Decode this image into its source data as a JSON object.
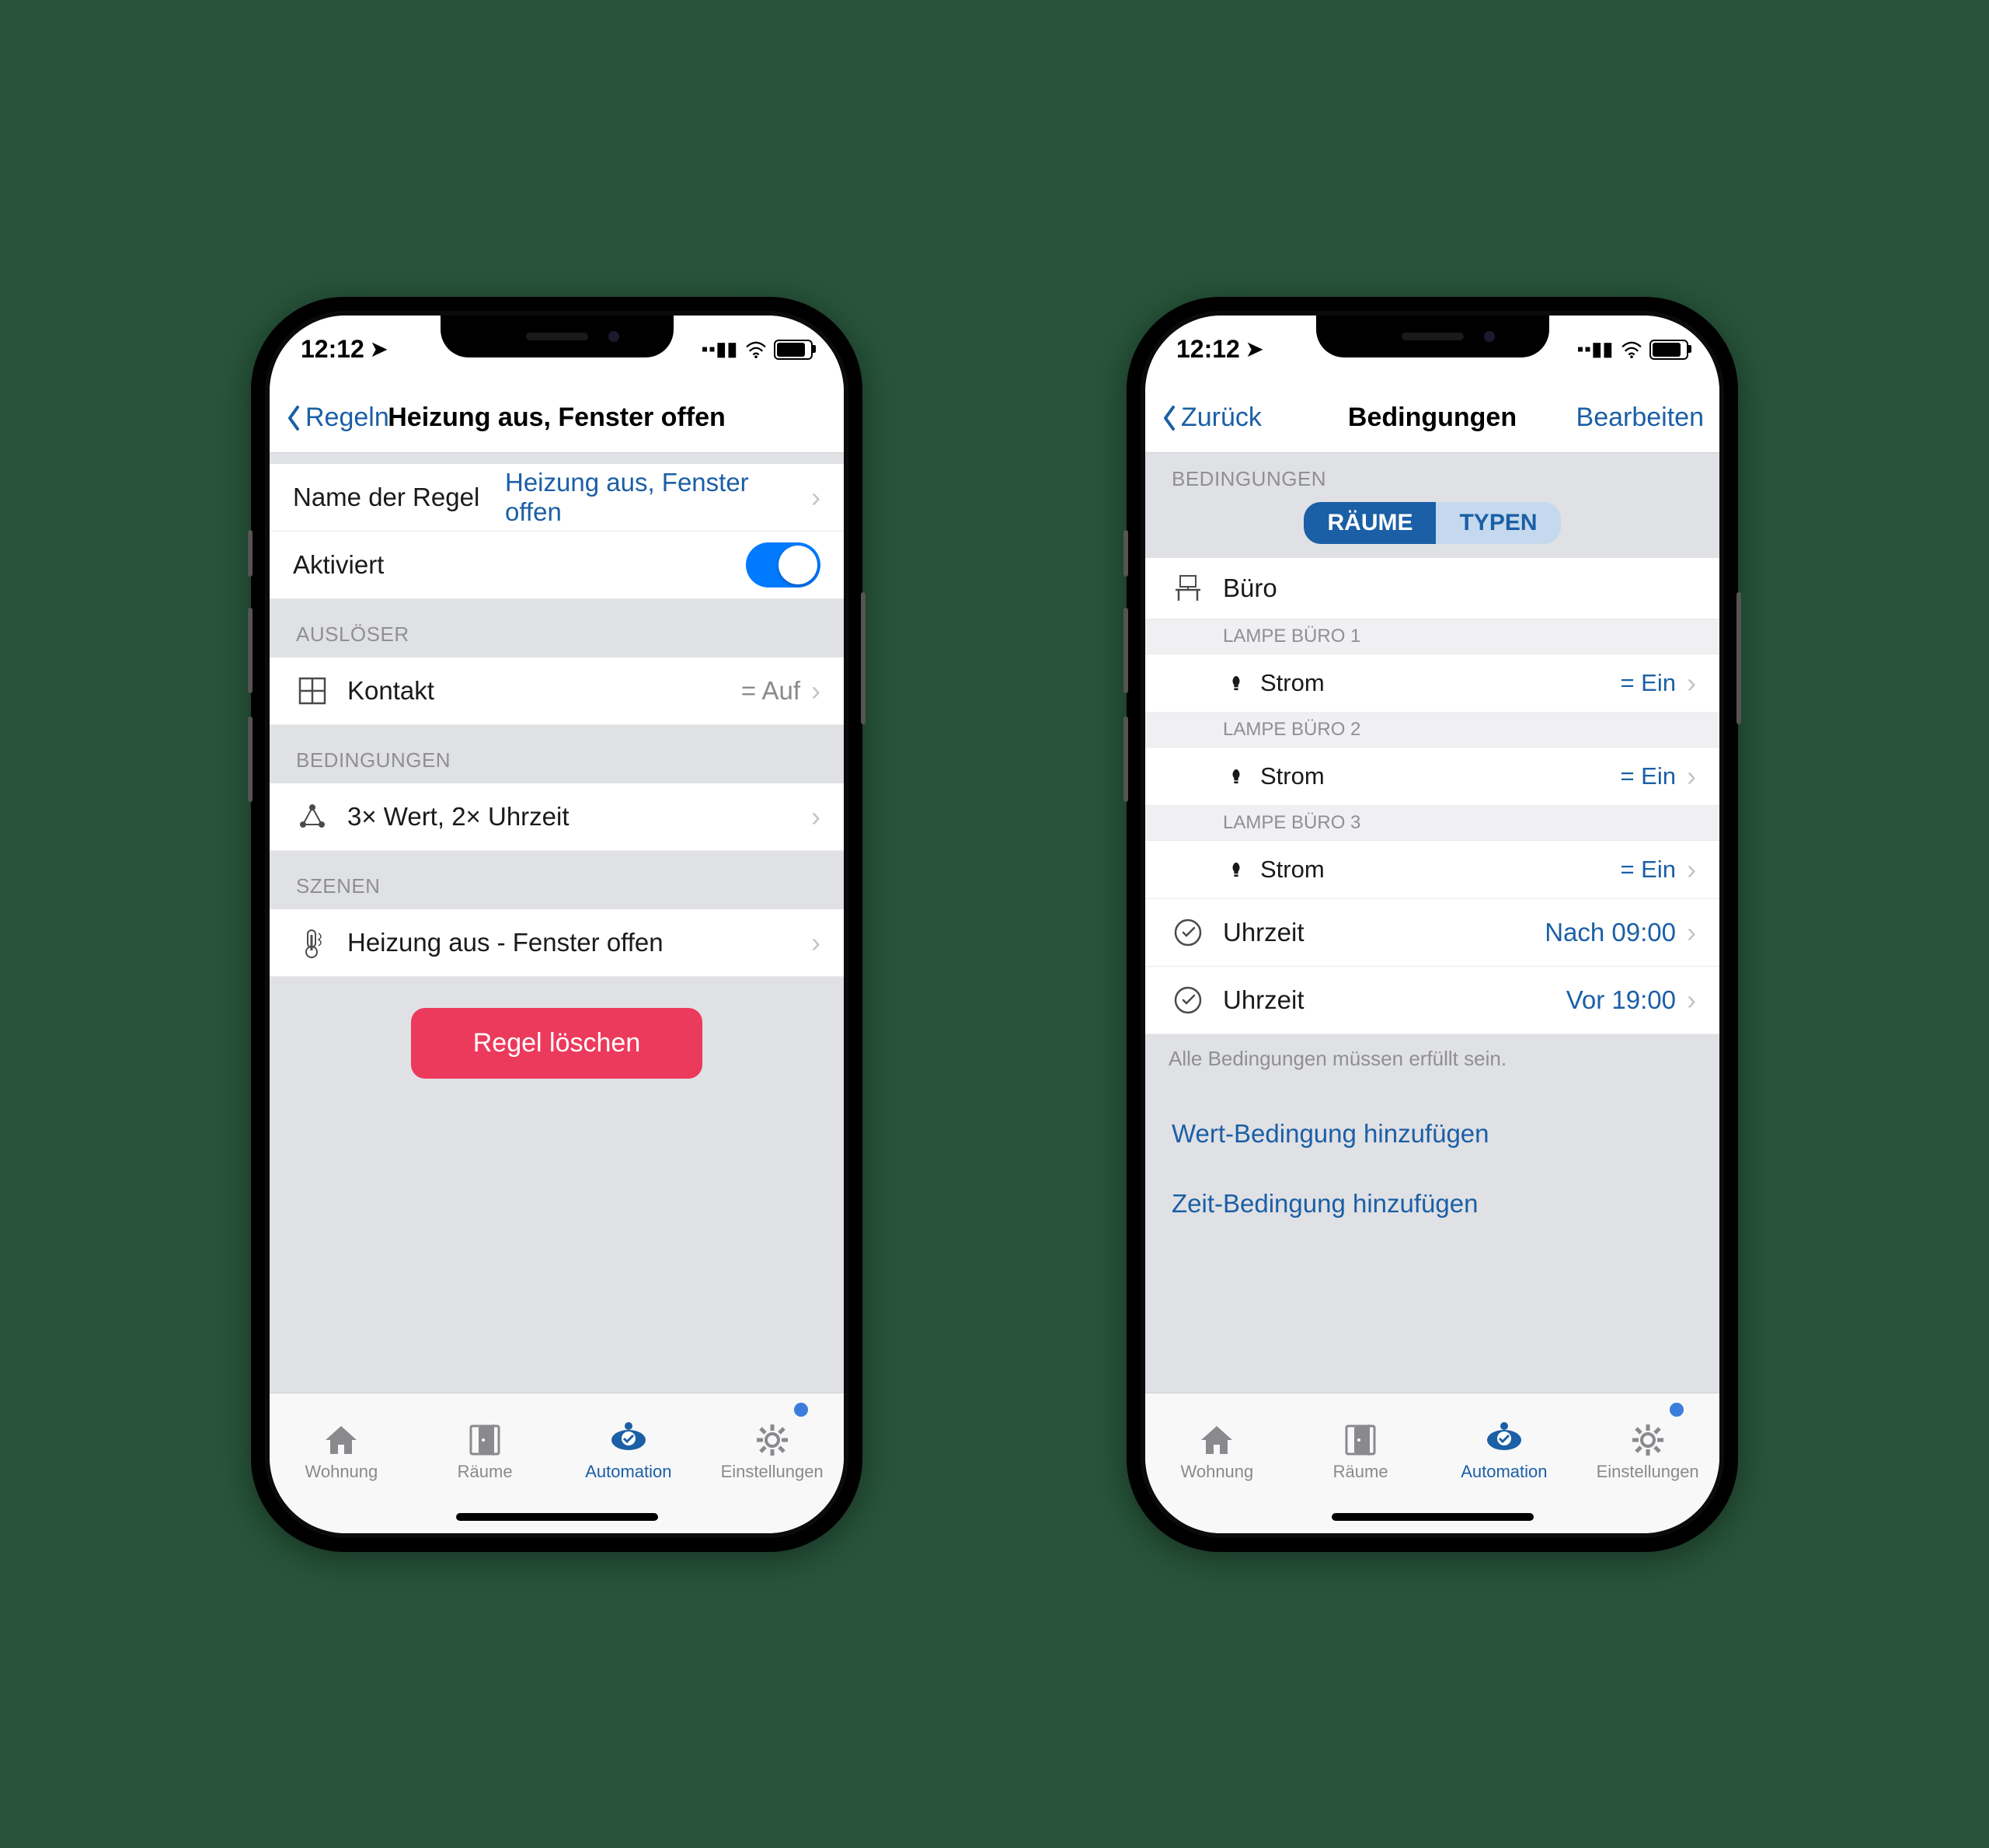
{
  "status": {
    "time": "12:12"
  },
  "left": {
    "nav": {
      "back": "Regeln",
      "title": "Heizung aus, Fenster offen"
    },
    "name_row": {
      "label": "Name der Regel",
      "value": "Heizung aus, Fenster offen"
    },
    "active_row": {
      "label": "Aktiviert",
      "on": true
    },
    "sections": {
      "trigger_header": "AUSLÖSER",
      "trigger": {
        "label": "Kontakt",
        "value": "= Auf"
      },
      "conditions_header": "BEDINGUNGEN",
      "conditions": {
        "label": "3× Wert, 2× Uhrzeit"
      },
      "scenes_header": "SZENEN",
      "scene": {
        "label": "Heizung aus - Fenster offen"
      }
    },
    "delete_btn": "Regel löschen"
  },
  "right": {
    "nav": {
      "back": "Zurück",
      "title": "Bedingungen",
      "right": "Bearbeiten"
    },
    "section_header": "BEDINGUNGEN",
    "segments": {
      "rooms": "RÄUME",
      "types": "TYPEN"
    },
    "room": "Büro",
    "devices": [
      {
        "group": "LAMPE BÜRO 1",
        "label": "Strom",
        "value": "= Ein"
      },
      {
        "group": "LAMPE BÜRO 2",
        "label": "Strom",
        "value": "= Ein"
      },
      {
        "group": "LAMPE BÜRO 3",
        "label": "Strom",
        "value": "= Ein"
      }
    ],
    "times": [
      {
        "label": "Uhrzeit",
        "value": "Nach 09:00"
      },
      {
        "label": "Uhrzeit",
        "value": "Vor 19:00"
      }
    ],
    "footnote": "Alle Bedingungen müssen erfüllt sein.",
    "add_value": "Wert-Bedingung hinzufügen",
    "add_time": "Zeit-Bedingung hinzufügen"
  },
  "tabbar": {
    "home": "Wohnung",
    "rooms": "Räume",
    "automation": "Automation",
    "settings": "Einstellungen"
  }
}
